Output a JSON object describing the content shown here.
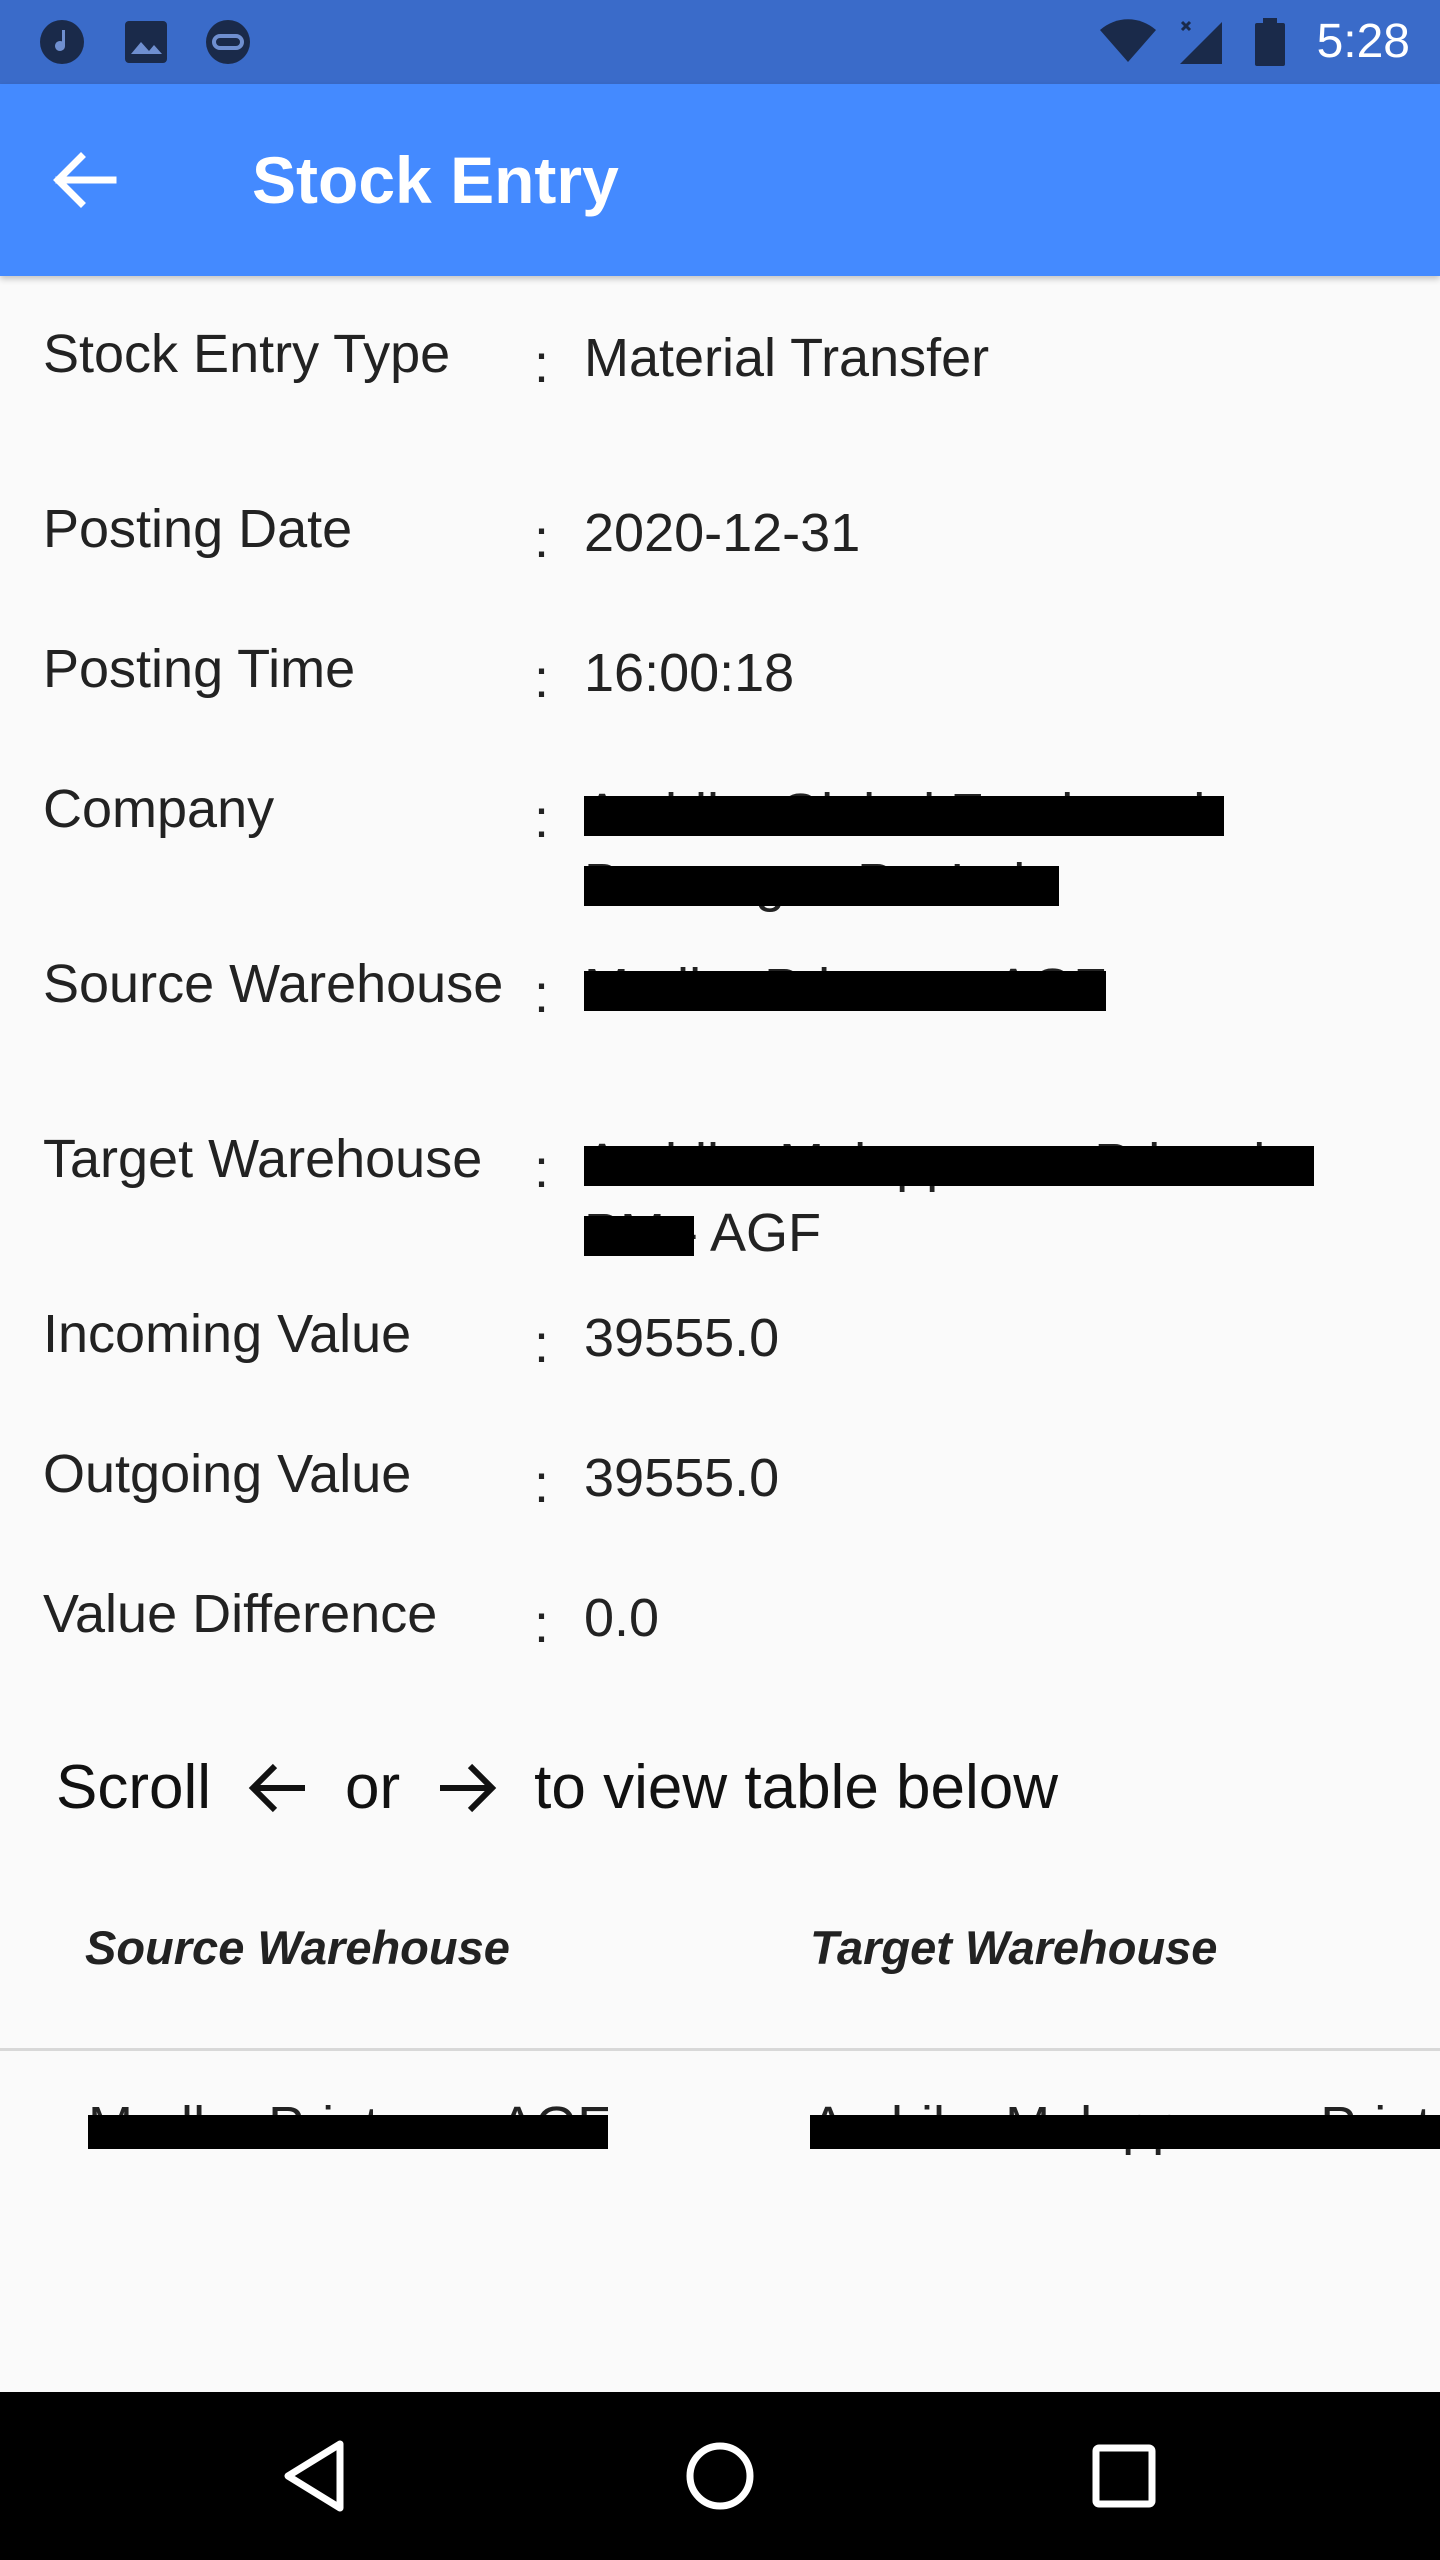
{
  "status_bar": {
    "time": "5:28",
    "left_icons": [
      "music-note-icon",
      "image-icon",
      "vpn-icon"
    ],
    "right_icons": [
      "wifi-icon",
      "signal-icon",
      "battery-icon"
    ]
  },
  "app_bar": {
    "title": "Stock Entry",
    "back_icon": "arrow-left-icon",
    "color": "#448aff"
  },
  "fields": [
    {
      "label": "Stock Entry Type",
      "value": "Material Transfer",
      "redacted": false
    },
    {
      "label": "Posting Date",
      "value": "2020-12-31",
      "redacted": false
    },
    {
      "label": "Posting Time",
      "value": "16:00:18",
      "redacted": false
    },
    {
      "label": "Company",
      "value": "Ambika Global Foods and Beverages Pvt Ltd",
      "redacted": true
    },
    {
      "label": "Source Warehouse",
      "value": "Madhu Printers - AGF",
      "redacted": true
    },
    {
      "label": "Target Warehouse",
      "value": "Ambika Malappuram Printed PM - AGF",
      "redacted": true
    },
    {
      "label": "Incoming Value",
      "value": "39555.0",
      "redacted": false
    },
    {
      "label": "Outgoing Value",
      "value": "39555.0",
      "redacted": false
    },
    {
      "label": "Value Difference",
      "value": "0.0",
      "redacted": false
    }
  ],
  "colon": ":",
  "scroll_hint": {
    "prefix": "Scroll",
    "middle": "or",
    "suffix": "to view table below"
  },
  "table": {
    "headers": [
      "Source Warehouse",
      "Target Warehouse"
    ],
    "rows": [
      [
        "Madhu Printers - AGF",
        "Ambika Malappuram Printed PM - AGF"
      ]
    ]
  },
  "nav_bar": {
    "buttons": [
      "back-triangle-icon",
      "home-circle-icon",
      "recents-square-icon"
    ]
  }
}
